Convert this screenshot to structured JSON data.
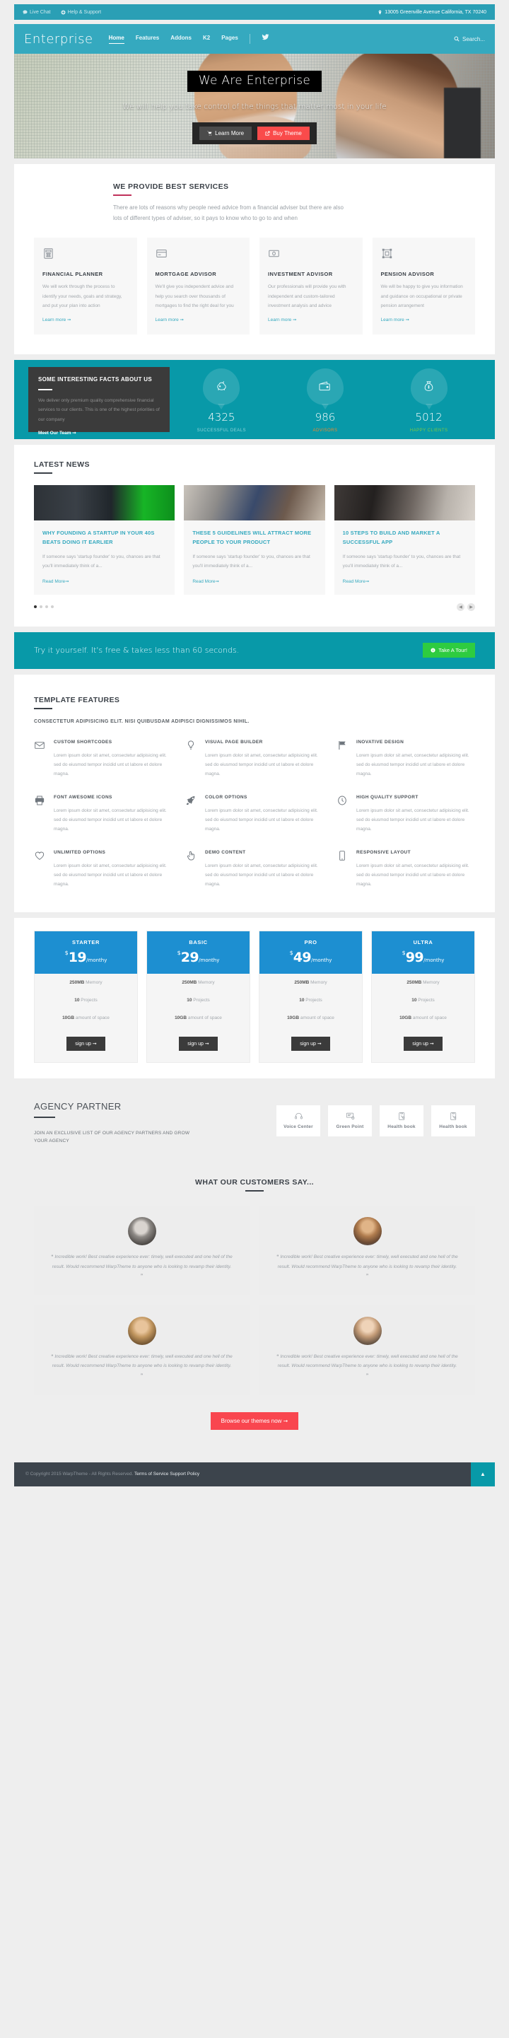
{
  "topbar": {
    "live_chat": "Live Chat",
    "help_support": "Help & Support",
    "address": "13005 Greenville Avenue California, TX 70240",
    "chat_icon": "chat-icon",
    "help_icon": "plus-circle-icon",
    "location_icon": "map-marker-icon"
  },
  "nav": {
    "logo": "Enterprise",
    "items": [
      {
        "label": "Home",
        "active": true
      },
      {
        "label": "Features",
        "active": false
      },
      {
        "label": "Addons",
        "active": false
      },
      {
        "label": "K2",
        "active": false
      },
      {
        "label": "Pages",
        "active": false
      }
    ],
    "twitter_icon": "twitter-icon",
    "search_label": "Search...",
    "search_icon": "search-icon"
  },
  "hero": {
    "title": "We Are Enterprise",
    "subtitle": "We will help you take control of the things that matter most in your life",
    "btn_primary": "Learn More",
    "btn_secondary": "Buy Theme",
    "btn_primary_icon": "cart-icon",
    "btn_secondary_icon": "external-link-icon"
  },
  "services": {
    "title": "WE PROVIDE BEST SERVICES",
    "lede": "There are lots of reasons why people need advice from a financial adviser but there are also lots of different types of adviser, so it pays to know who to go to and when",
    "link_label": "Learn more",
    "items": [
      {
        "icon": "calculator-icon",
        "title": "FINANCIAL PLANNER",
        "text": "We will work through the process to identify your needs, goals and strategy, and put your plan into action"
      },
      {
        "icon": "credit-card-icon",
        "title": "MORTGAGE ADVISOR",
        "text": "We'll give you independent advice and help you search over thousands of mortgages to find the right deal for you"
      },
      {
        "icon": "money-icon",
        "title": "INVESTMENT ADVISOR",
        "text": "Our professionals will provide you with independent and custom-tailored investment analysis and advice"
      },
      {
        "icon": "crop-icon",
        "title": "PENSION ADVISOR",
        "text": "We will be happy to give you information and guidance on occupational or private pension arrangement"
      }
    ]
  },
  "facts": {
    "title": "SOME INTERESTING FACTS ABOUT US",
    "text": "We deliver only premium quality comprehensive financial services to our clients. This is one of the highest priorities of our company",
    "link_label": "Meet Our Team",
    "counters": [
      {
        "icon": "piggy-bank-icon",
        "value": "4325",
        "label": "SUCCESSFUL DEALS",
        "color": "#8fd3d8"
      },
      {
        "icon": "wallet-icon",
        "value": "986",
        "label": "ADVISORS",
        "color": "#f0872b"
      },
      {
        "icon": "money-bag-icon",
        "value": "5012",
        "label": "HAPPY CLIENTS",
        "color": "#7ec943"
      }
    ]
  },
  "news": {
    "title": "LATEST NEWS",
    "read_more": "Read More",
    "items": [
      {
        "title": "WHY FOUNDING A STARTUP IN YOUR 40S BEATS DOING IT EARLIER",
        "text": "If someone says 'startup founder' to you, chances are that you'll immediately think of a..."
      },
      {
        "title": "THESE 5 GUIDELINES WILL ATTRACT MORE PEOPLE TO YOUR PRODUCT",
        "text": "If someone says 'startup founder' to you, chances are that you'll immediately think of a..."
      },
      {
        "title": "10 STEPS TO BUILD AND MARKET A SUCCESSFUL APP",
        "text": "If someone says 'startup founder' to you, chances are that you'll immediately think of a..."
      }
    ],
    "dots": 4,
    "active_dot": 0,
    "prev_icon": "chevron-left-icon",
    "next_icon": "chevron-right-icon"
  },
  "cta": {
    "text": "Try it yourself. It's free & takes less than 60 seconds.",
    "button": "Take A Tour!",
    "button_icon": "info-circle-icon"
  },
  "features": {
    "title": "TEMPLATE FEATURES",
    "subtitle": "CONSECTETUR ADIPISICING ELIT. NISI QUIBUSDAM ADIPISCI DIGNISSIMOS NIHIL.",
    "body": "Lorem ipsum dolor sit amet, consectetur adipisicing elit. sed do eiusmod tempor incidid unt ut labore et dolore magna.",
    "items": [
      {
        "icon": "envelope-icon",
        "title": "CUSTOM SHORTCODES"
      },
      {
        "icon": "lightbulb-icon",
        "title": "VISUAL PAGE BUILDER"
      },
      {
        "icon": "flag-icon",
        "title": "INOVATIVE DESIGN"
      },
      {
        "icon": "printer-icon",
        "title": "FONT AWESOME ICONS"
      },
      {
        "icon": "rocket-icon",
        "title": "COLOR OPTIONS"
      },
      {
        "icon": "clock-icon",
        "title": "HIGH QUALITY SUPPORT"
      },
      {
        "icon": "heart-icon",
        "title": "UNLIMITED OPTIONS"
      },
      {
        "icon": "hand-pointer-icon",
        "title": "DEMO CONTENT"
      },
      {
        "icon": "mobile-icon",
        "title": "RESPONSIVE LAYOUT"
      }
    ]
  },
  "pricing": {
    "signup_label": "sign up",
    "currency": "$",
    "period": "/monthy",
    "plans": [
      {
        "name": "STARTER",
        "price": "19",
        "memory": "250MB",
        "memory_label": "Memory",
        "projects": "10",
        "projects_label": "Projects",
        "space": "10GB",
        "space_label": "amount of space"
      },
      {
        "name": "BASIC",
        "price": "29",
        "memory": "250MB",
        "memory_label": "Memory",
        "projects": "10",
        "projects_label": "Projects",
        "space": "10GB",
        "space_label": "amount of space"
      },
      {
        "name": "PRO",
        "price": "49",
        "memory": "250MB",
        "memory_label": "Memory",
        "projects": "10",
        "projects_label": "Projects",
        "space": "10GB",
        "space_label": "amount of space"
      },
      {
        "name": "ULTRA",
        "price": "99",
        "memory": "250MB",
        "memory_label": "Memory",
        "projects": "10",
        "projects_label": "Projects",
        "space": "10GB",
        "space_label": "amount of space"
      }
    ]
  },
  "partners": {
    "title": "AGENCY PARTNER",
    "text": "JOIN AN EXCLUSIVE LIST OF OUR AGENCY PARTNERS AND GROW YOUR AGENCY",
    "logos": [
      {
        "icon": "headset-icon",
        "name": "Voice Center"
      },
      {
        "icon": "monitor-icon",
        "name": "Green Point"
      },
      {
        "icon": "clipboard-icon",
        "name": "Health book"
      },
      {
        "icon": "clipboard-icon",
        "name": "Health book"
      }
    ]
  },
  "testimonials": {
    "title": "WHAT OUR CUSTOMERS SAY...",
    "quote_open": "“",
    "quote_close": "”",
    "items": [
      {
        "avatar": "avatar-woman-1",
        "text": "Incredible work! Best creative experience ever: timely, well executed and one hell of the result. Would recommend WarpTheme to anyone who is looking to revamp their identity."
      },
      {
        "avatar": "avatar-man-1",
        "text": "Incredible work! Best creative experience ever: timely, well executed and one hell of the result. Would recommend WarpTheme to anyone who is looking to revamp their identity."
      },
      {
        "avatar": "avatar-man-2",
        "text": "Incredible work! Best creative experience ever: timely, well executed and one hell of the result. Would recommend WarpTheme to anyone who is looking to revamp their identity."
      },
      {
        "avatar": "avatar-man-3",
        "text": "Incredible work! Best creative experience ever: timely, well executed and one hell of the result. Would recommend WarpTheme to anyone who is looking to revamp their identity."
      }
    ],
    "browse_button": "Browse our themes now"
  },
  "footer": {
    "copyright": "© Copyright 2015 WarpTheme - All Rights Reserved.",
    "links": "Terms of Service Support Policy",
    "to_top_icon": "chevron-up-icon"
  },
  "colors": {
    "teal": "#35a9bf",
    "teal_dark": "#0899a8",
    "red": "#f9464f",
    "blue": "#1d8fd1",
    "green": "#2ecc40",
    "magenta": "#c0315b"
  }
}
